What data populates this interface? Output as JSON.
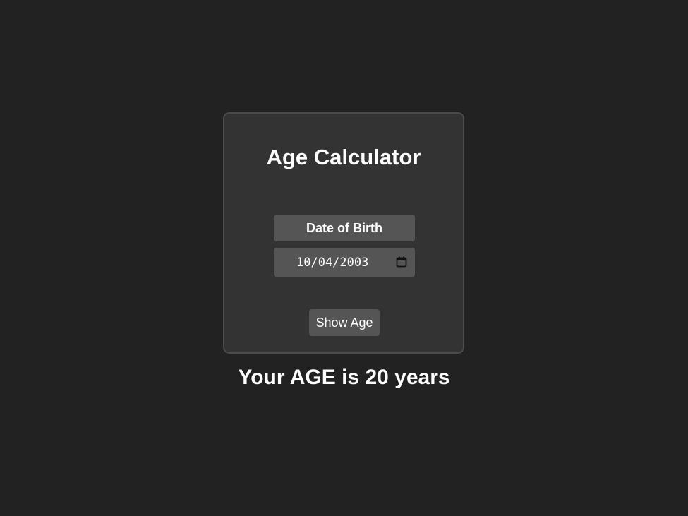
{
  "app": {
    "title": "Age Calculator"
  },
  "form": {
    "dob_label": "Date of Birth",
    "dob_value": "10/04/2003",
    "calendar_icon": "calendar-icon",
    "submit_label": "Show Age"
  },
  "result": {
    "text": "Your AGE is 20 years"
  },
  "colors": {
    "background": "#222222",
    "card": "#333333",
    "card_border": "#4a4a4a",
    "control": "#555555",
    "text": "#ffffff"
  }
}
